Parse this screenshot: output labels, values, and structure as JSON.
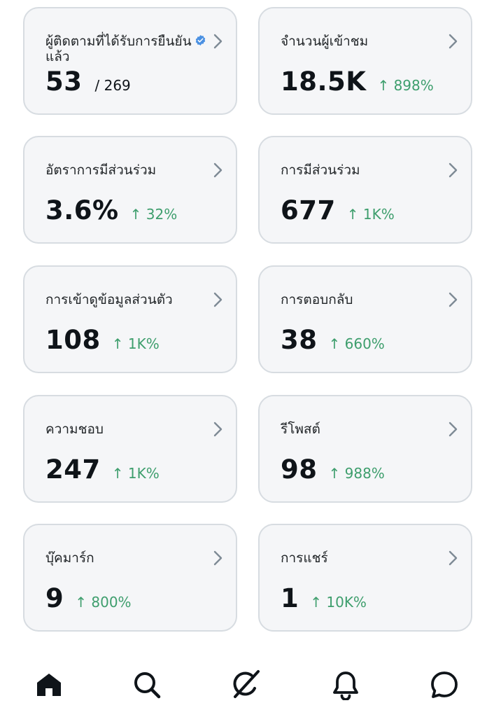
{
  "cards": [
    {
      "label": "ผู้ติดตามที่ได้รับการยืนยันแล้ว",
      "value": "53",
      "total": "/ 269",
      "change": ""
    },
    {
      "label": "จำนวนผู้เข้าชม",
      "value": "18.5K",
      "total": "",
      "change": "↑ 898%"
    },
    {
      "label": "อัตราการมีส่วนร่วม",
      "value": "3.6%",
      "total": "",
      "change": "↑ 32%"
    },
    {
      "label": "การมีส่วนร่วม",
      "value": "677",
      "total": "",
      "change": "↑ 1K%"
    },
    {
      "label": "การเข้าดูข้อมูลส่วนตัว",
      "value": "108",
      "total": "",
      "change": "↑ 1K%"
    },
    {
      "label": "การตอบกลับ",
      "value": "38",
      "total": "",
      "change": "↑ 660%"
    },
    {
      "label": "ความชอบ",
      "value": "247",
      "total": "",
      "change": "↑ 1K%"
    },
    {
      "label": "รีโพสต์",
      "value": "98",
      "total": "",
      "change": "↑ 988%"
    },
    {
      "label": "บุ๊คมาร์ก",
      "value": "9",
      "total": "",
      "change": "↑ 800%"
    },
    {
      "label": "การแชร์",
      "value": "1",
      "total": "",
      "change": "↑ 10K%"
    }
  ],
  "tabbar": {
    "items": [
      "home-icon",
      "search-icon",
      "grok-icon",
      "notifications-icon",
      "messages-icon"
    ],
    "active": "home-icon"
  },
  "colors": {
    "card_bg": "#f5f6f8",
    "card_border": "#d7dce1",
    "positive": "#3e9e6d",
    "verified": "#4a90e2",
    "chevron": "#7e8a95",
    "icon": "#0f1419"
  }
}
